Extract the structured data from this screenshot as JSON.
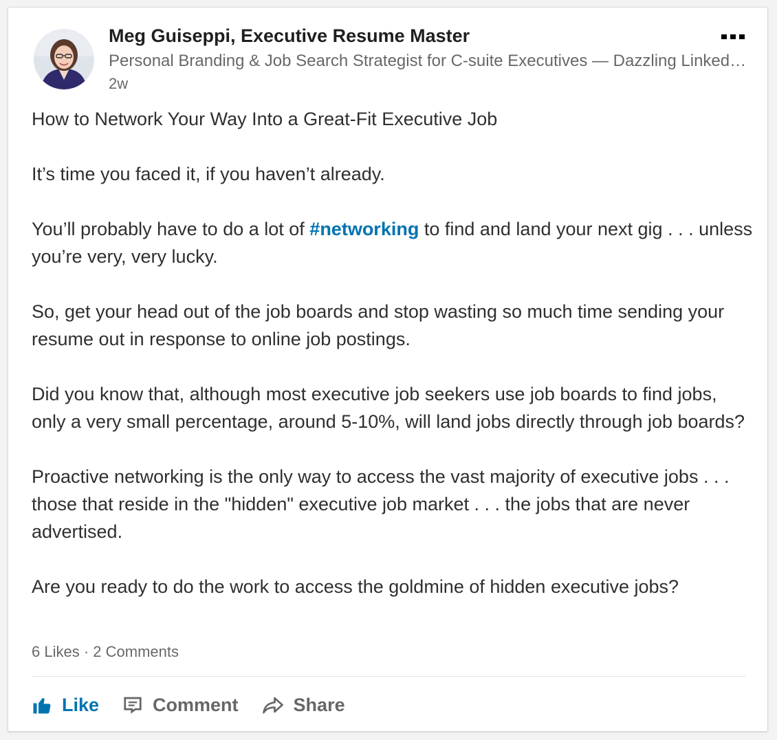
{
  "author": {
    "name": "Meg Guiseppi, Executive Resume Master",
    "headline": "Personal Branding & Job Search Strategist for C-suite Executives — Dazzling LinkedIn Profiles & Executive Resumes",
    "time": "2w"
  },
  "post": {
    "title": "How to Network Your Way Into a Great-Fit Executive Job",
    "p1": "It’s time you faced it, if you haven’t already.",
    "p2_before": "You’ll probably have to do a lot of ",
    "p2_hashtag": "#networking",
    "p2_after": " to find and land your next gig . . . unless you’re very, very lucky.",
    "p3": "So, get your head out of the job boards and stop wasting so much time sending your resume out in response to online job postings.",
    "p4": "Did you know that, although most executive job seekers use job boards to find jobs, only a very small percentage, around 5-10%, will land jobs directly through job boards?",
    "p5": "Proactive networking is the only way to access the vast majority of executive jobs . . . those that reside in the \"hidden\" executive job market . . . the jobs that are never advertised.",
    "p6": "Are you ready to do the work to access the goldmine of hidden executive jobs?"
  },
  "social": {
    "likes": "6 Likes",
    "separator": " · ",
    "comments": "2 Comments"
  },
  "actions": {
    "like": "Like",
    "comment": "Comment",
    "share": "Share"
  },
  "icons": {
    "more": "more-options-icon",
    "like": "thumbs-up-icon",
    "comment": "comment-bubble-icon",
    "share": "share-arrow-icon"
  },
  "colors": {
    "accent": "#0073b1",
    "text": "#333333",
    "muted": "#666666"
  }
}
